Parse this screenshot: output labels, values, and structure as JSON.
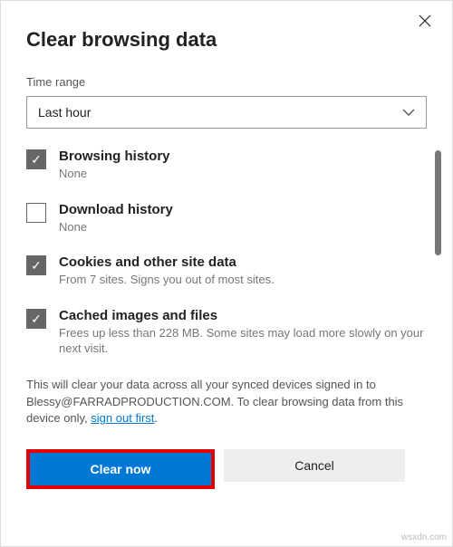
{
  "dialog": {
    "title": "Clear browsing data",
    "close_label": "Close"
  },
  "time_range": {
    "label": "Time range",
    "value": "Last hour"
  },
  "options": [
    {
      "checked": true,
      "title": "Browsing history",
      "desc": "None"
    },
    {
      "checked": false,
      "title": "Download history",
      "desc": "None"
    },
    {
      "checked": true,
      "title": "Cookies and other site data",
      "desc": "From 7 sites. Signs you out of most sites."
    },
    {
      "checked": true,
      "title": "Cached images and files",
      "desc": "Frees up less than 228 MB. Some sites may load more slowly on your next visit."
    }
  ],
  "info": {
    "text_before": "This will clear your data across all your synced devices signed in to Blessy@FARRADPRODUCTION.COM. To clear browsing data from this device only, ",
    "link": "sign out first",
    "text_after": "."
  },
  "buttons": {
    "primary": "Clear now",
    "secondary": "Cancel"
  },
  "watermark": "wsxdn.com"
}
